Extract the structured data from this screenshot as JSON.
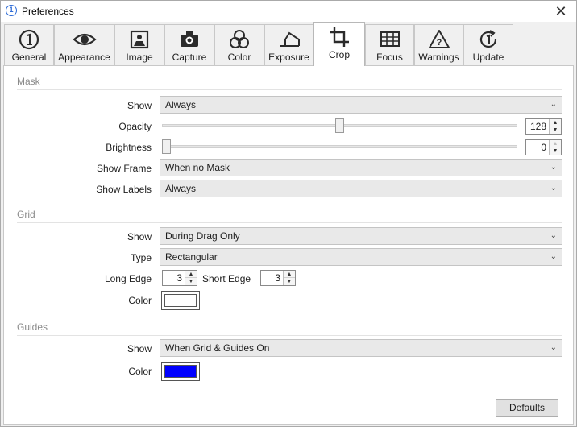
{
  "window": {
    "title": "Preferences",
    "app_icon_glyph": "1",
    "close_glyph": "✕"
  },
  "tabs": [
    {
      "label": "General",
      "icon": "numbered-circle-icon"
    },
    {
      "label": "Appearance",
      "icon": "eye-icon"
    },
    {
      "label": "Image",
      "icon": "picture-icon"
    },
    {
      "label": "Capture",
      "icon": "camera-icon"
    },
    {
      "label": "Color",
      "icon": "color-circles-icon"
    },
    {
      "label": "Exposure",
      "icon": "exposure-icon"
    },
    {
      "label": "Crop",
      "icon": "crop-icon",
      "active": true
    },
    {
      "label": "Focus",
      "icon": "focus-grid-icon"
    },
    {
      "label": "Warnings",
      "icon": "warning-icon"
    },
    {
      "label": "Update",
      "icon": "update-icon"
    }
  ],
  "mask": {
    "header": "Mask",
    "show_label": "Show",
    "show_value": "Always",
    "opacity_label": "Opacity",
    "opacity_value": "128",
    "opacity_fraction": 0.5,
    "brightness_label": "Brightness",
    "brightness_value": "0",
    "brightness_fraction": 0.0,
    "show_frame_label": "Show Frame",
    "show_frame_value": "When no Mask",
    "show_labels_label": "Show Labels",
    "show_labels_value": "Always"
  },
  "grid": {
    "header": "Grid",
    "show_label": "Show",
    "show_value": "During Drag Only",
    "type_label": "Type",
    "type_value": "Rectangular",
    "long_edge_label": "Long Edge",
    "long_edge_value": "3",
    "short_edge_label": "Short Edge",
    "short_edge_value": "3",
    "color_label": "Color",
    "color_value": "#ffffff"
  },
  "guides": {
    "header": "Guides",
    "show_label": "Show",
    "show_value": "When Grid & Guides On",
    "color_label": "Color",
    "color_value": "#0000ff"
  },
  "buttons": {
    "defaults": "Defaults"
  },
  "glyphs": {
    "chevron": "⌄",
    "up": "▲",
    "down": "▼"
  }
}
